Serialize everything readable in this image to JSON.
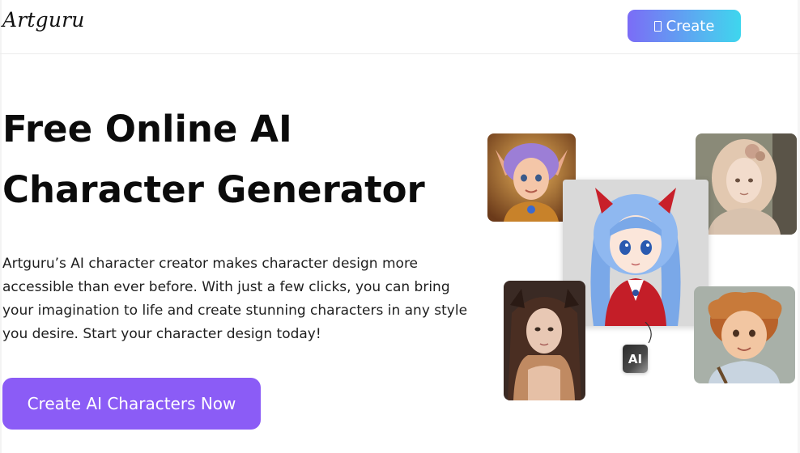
{
  "header": {
    "logo": "Artguru",
    "create_button_label": "Create",
    "create_button_icon": "square-icon"
  },
  "hero": {
    "title_line1": "Free Online AI",
    "title_line2": "Character Generator",
    "description": "Artguru’s AI character creator makes character design more accessible than ever before. With just a few clicks, you can bring your imagination to life and create stunning characters in any style you desire. Start your character design today!",
    "cta_label": "Create AI Characters Now"
  },
  "collage": {
    "ai_badge": "AI",
    "images": [
      "elf-girl-portrait",
      "fantasy-girl-portrait",
      "anime-girl-portrait",
      "dark-haired-woman-portrait",
      "cartoon-boy-portrait"
    ]
  },
  "colors": {
    "cta_purple": "#8b5cf6",
    "gradient_start": "#7b6cf6",
    "gradient_end": "#3ed6ee"
  }
}
